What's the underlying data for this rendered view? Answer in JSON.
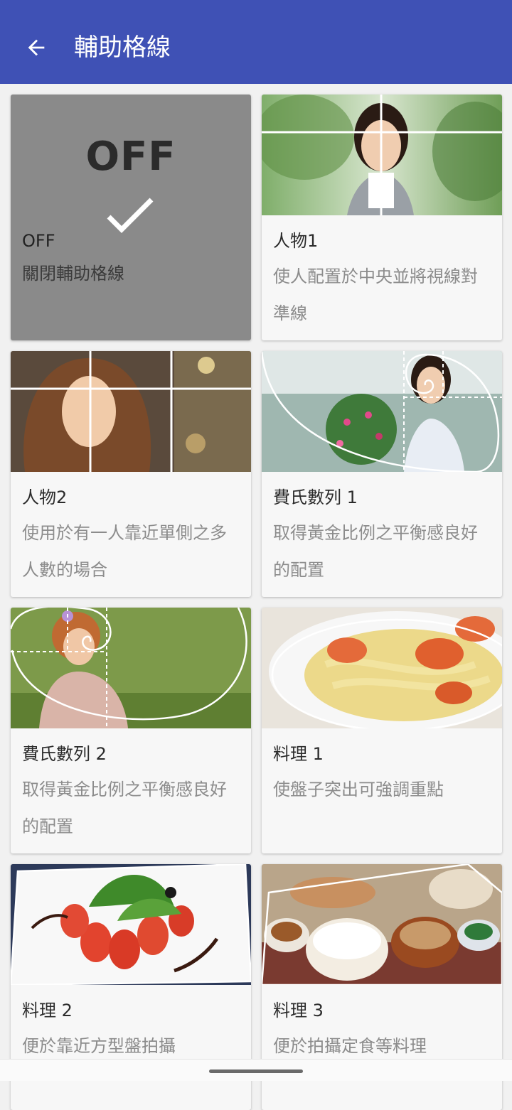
{
  "appbar": {
    "title": "輔助格線",
    "back_icon": "arrow-back-icon",
    "color": "#3f51b5"
  },
  "cards": [
    {
      "id": "off",
      "title": "OFF",
      "desc": "關閉輔助格線",
      "overlay_label": "OFF",
      "selected": true
    },
    {
      "id": "person1",
      "title": "人物1",
      "desc": "使人配置於中央並將視線對準線"
    },
    {
      "id": "person2",
      "title": "人物2",
      "desc": "使用於有一人靠近單側之多人數的場合"
    },
    {
      "id": "fib1",
      "title": "費氏數列 1",
      "desc": "取得黃金比例之平衡感良好的配置"
    },
    {
      "id": "fib2",
      "title": "費氏數列 2",
      "desc": "取得黃金比例之平衡感良好的配置"
    },
    {
      "id": "food1",
      "title": "料理 1",
      "desc": "使盤子突出可強調重點"
    },
    {
      "id": "food2",
      "title": "料理 2",
      "desc": "便於靠近方型盤拍攝"
    },
    {
      "id": "food3",
      "title": "料理 3",
      "desc": "便於拍攝定食等料理"
    }
  ]
}
